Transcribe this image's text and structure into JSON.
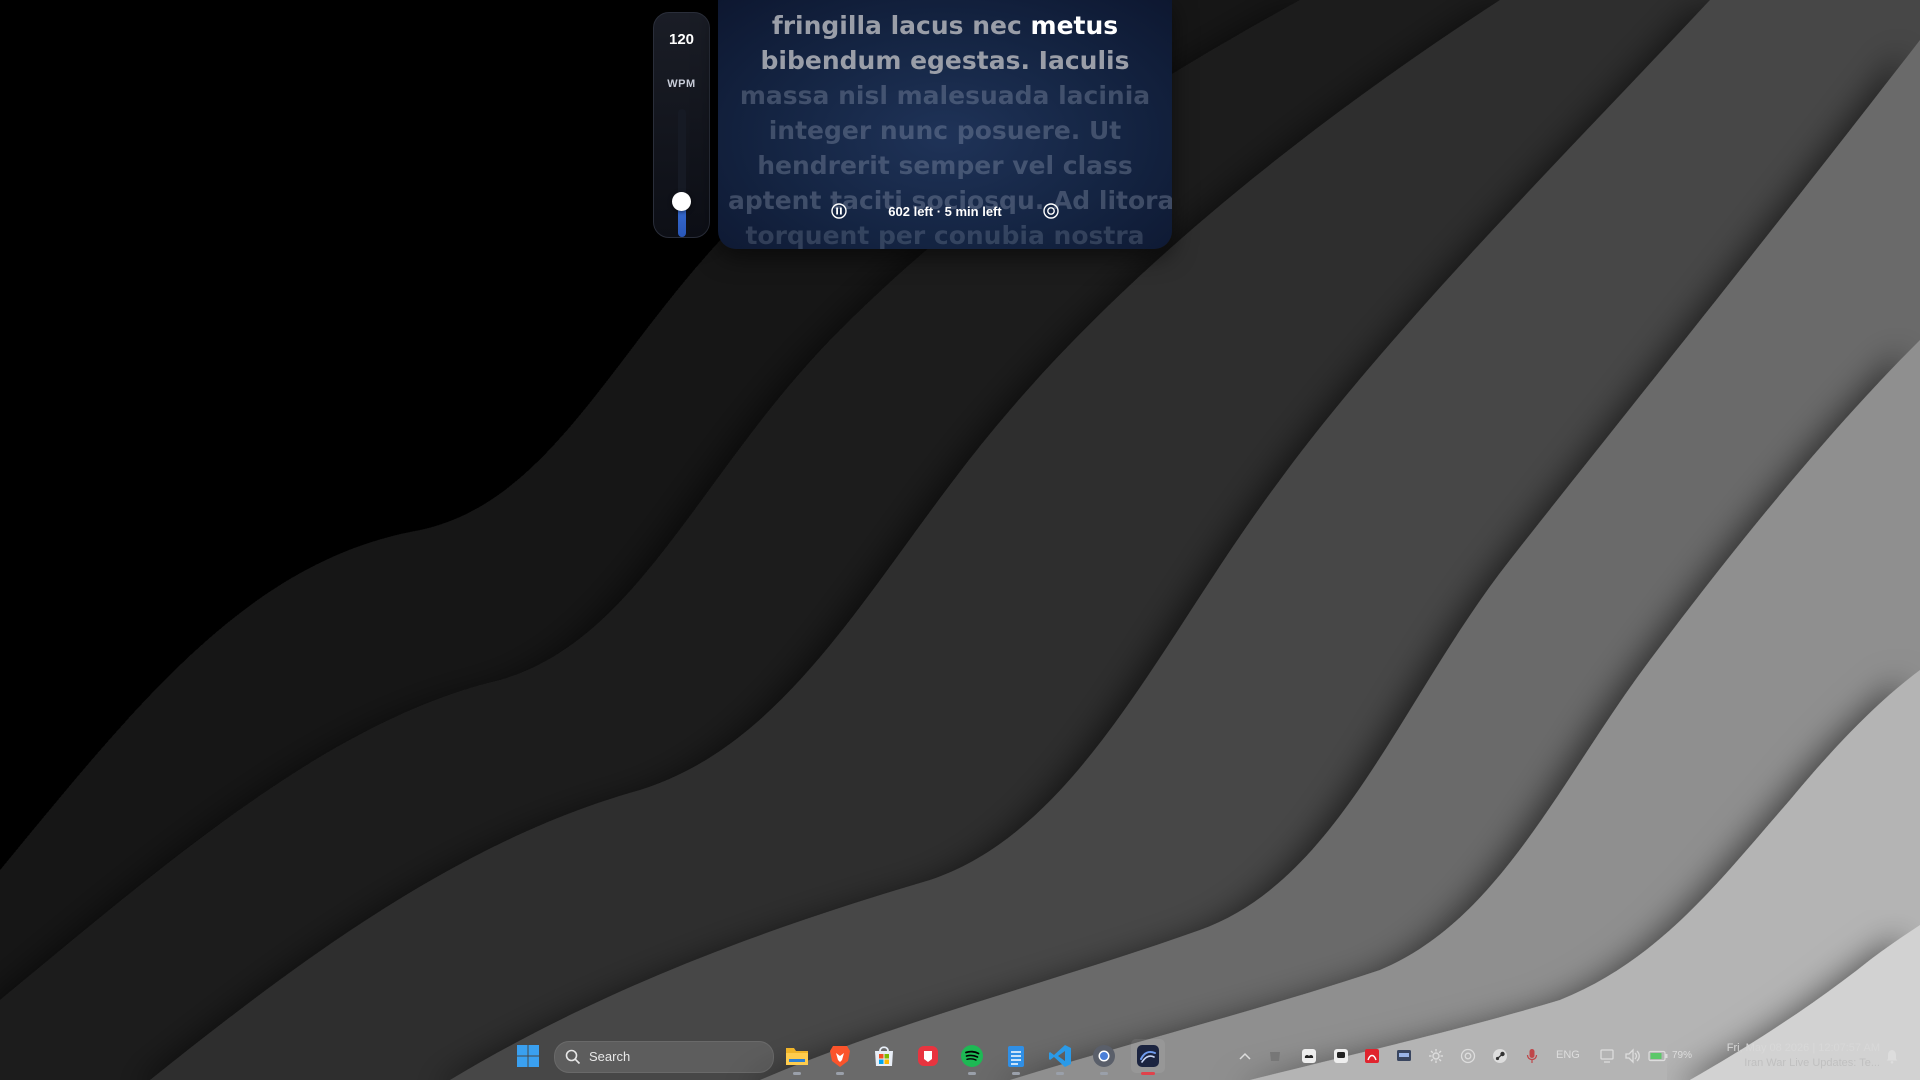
{
  "wpm": {
    "value": "120",
    "unit": "WPM",
    "level": 0.28
  },
  "reader": {
    "lines": [
      {
        "segments": [
          {
            "text": "fringilla lacus nec ",
            "state": "read"
          },
          {
            "text": "metus",
            "state": "current"
          }
        ]
      },
      {
        "segments": [
          {
            "text": "bibendum egestas. Iaculis",
            "state": "read"
          }
        ]
      },
      {
        "segments": [
          {
            "text": "massa nisl malesuada lacinia",
            "state": "upcoming"
          }
        ]
      },
      {
        "segments": [
          {
            "text": "integer nunc posuere. Ut",
            "state": "upcoming"
          }
        ]
      },
      {
        "segments": [
          {
            "text": "hendrerit semper vel class",
            "state": "upcoming"
          }
        ]
      },
      {
        "segments": [
          {
            "text": "aptent taciti sociosqu. Ad litora",
            "state": "upcoming"
          }
        ]
      },
      {
        "segments": [
          {
            "text": "torquent per conubia nostra",
            "state": "faded"
          }
        ]
      }
    ],
    "progress_text": "602 left · 5 min left",
    "pause_icon": "pause-icon",
    "target_icon": "target-icon"
  },
  "taskbar": {
    "search_label": "Search",
    "apps": [
      {
        "name": "start-button",
        "icon": "windows-icon"
      },
      {
        "name": "file-explorer",
        "icon": "folder-icon"
      },
      {
        "name": "brave-browser",
        "icon": "brave-icon"
      },
      {
        "name": "microsoft-store",
        "icon": "store-icon"
      },
      {
        "name": "red-app",
        "icon": "red-app-icon"
      },
      {
        "name": "spotify",
        "icon": "spotify-icon"
      },
      {
        "name": "notepad",
        "icon": "notepad-icon"
      },
      {
        "name": "vscode",
        "icon": "vscode-icon"
      },
      {
        "name": "chrome",
        "icon": "chrome-icon"
      },
      {
        "name": "reader-app",
        "icon": "reader-app-icon"
      }
    ],
    "tray": {
      "language": "ENG",
      "battery": "79%",
      "datetime": "Fri, May 08 2026 | 12:07:57 AM",
      "news": "Iran War Live Updates: Te..."
    }
  },
  "colors": {
    "accent_blue": "#3a6fd6",
    "panel_bg": "#142442",
    "spotify_green": "#1db954",
    "active_red": "#e0424b"
  }
}
